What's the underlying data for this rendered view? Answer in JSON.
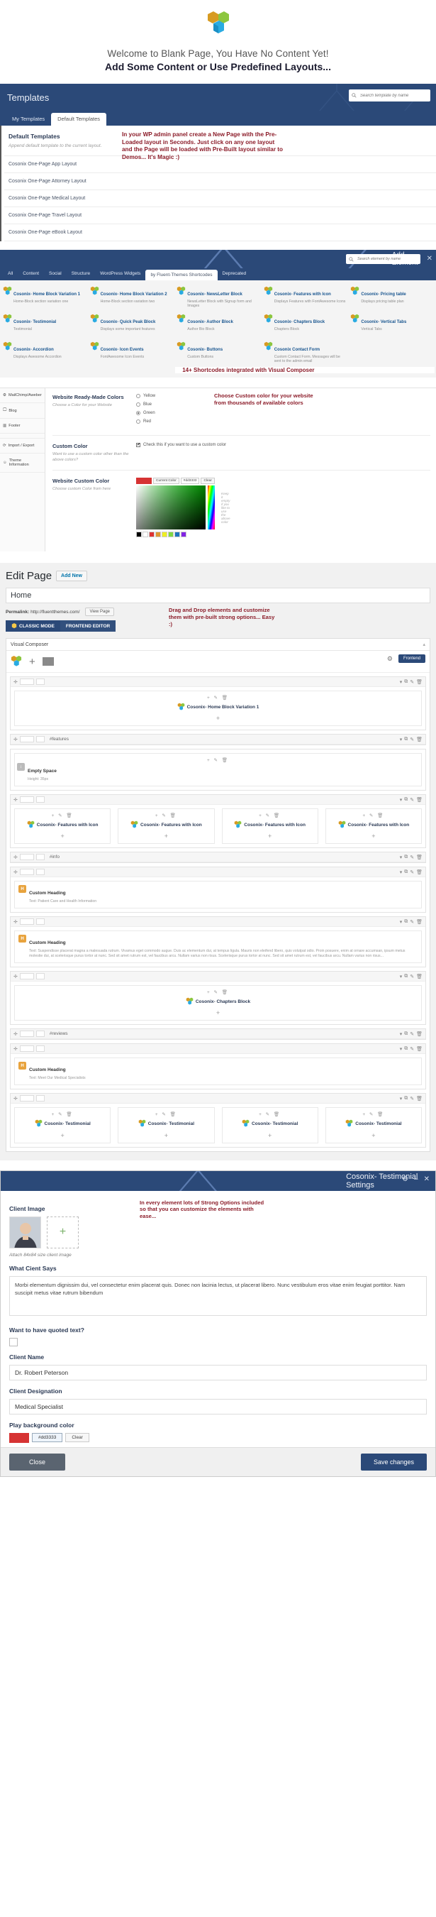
{
  "hero": {
    "logo_icon": "fluent-themes-logo",
    "line1": "Welcome to Blank Page, You Have No Content Yet!",
    "line2": "Add Some Content or Use Predefined Layouts..."
  },
  "templates_panel": {
    "title": "Templates",
    "search_placeholder": "Search template by name",
    "search_icon": "search-icon",
    "tabs": [
      {
        "label": "My Templates",
        "active": false
      },
      {
        "label": "Default Templates",
        "active": true
      }
    ],
    "section_title": "Default Templates",
    "section_sub": "Append default template to the current layout.",
    "rows": [
      "Cosonix One-Page App Layout",
      "Cosonix One-Page Attorney Layout",
      "Cosonix One-Page Medical Layout",
      "Cosonix One-Page Travel Layout",
      "Cosonix One-Page eBook Layout"
    ],
    "annotation": "In your WP admin panel create a New Page with the Pre-Loaded layout in Seconds. Just click on any one layout and the Page will be loaded with Pre-Built layout similar to Demos... It's Magic :)"
  },
  "add_element": {
    "title": "Add Element",
    "search_placeholder": "Search element by name",
    "search_icon": "search-icon",
    "close_icon": "close-icon",
    "tabs": [
      {
        "label": "All",
        "active": false
      },
      {
        "label": "Content",
        "active": false
      },
      {
        "label": "Social",
        "active": false
      },
      {
        "label": "Structure",
        "active": false
      },
      {
        "label": "WordPress Widgets",
        "active": false
      },
      {
        "label": "by Fluent-Themes Shortcodes",
        "active": true
      },
      {
        "label": "Deprecated",
        "active": false
      }
    ],
    "shortcodes": [
      {
        "title": "Cosonix- Home Block Variation 1",
        "desc": "Home-Block section variation one"
      },
      {
        "title": "Cosonix- Home Block Variation 2",
        "desc": "Home-Block section variation two"
      },
      {
        "title": "Cosonix- NewsLetter Block",
        "desc": "NewsLetter Block with Signup form and Images"
      },
      {
        "title": "Cosonix- Features with Icon",
        "desc": "Displays Features with FontAwesome Icons"
      },
      {
        "title": "Cosonix- Pricing table",
        "desc": "Displays pricing table plan"
      },
      {
        "title": "Cosonix- Testimonial",
        "desc": "Testimonial"
      },
      {
        "title": "Cosonix- Quick Peak Block",
        "desc": "Displays some important features"
      },
      {
        "title": "Cosonix- Author Block",
        "desc": "Author Bio Block"
      },
      {
        "title": "Cosonix- Chapters Block",
        "desc": "Chapters Block"
      },
      {
        "title": "Cosonix- Vertical Tabs",
        "desc": "Vertical Tabs"
      },
      {
        "title": "Cosonix- Accordion",
        "desc": "Displays Awesome Accordion"
      },
      {
        "title": "Cosonix- Icon Events",
        "desc": "FontAwesome Icon Events"
      },
      {
        "title": "Cosonix- Buttons",
        "desc": "Custom Buttons"
      },
      {
        "title": "Cosonix Contact Form",
        "desc": "Custom Contact Form. Messages will be sent to the admin email"
      }
    ],
    "note": "14+ Shortcodes integrated with Visual Composer"
  },
  "color_options": {
    "sidebar": [
      {
        "label": "MailChimp/Aweber",
        "icon": "gear-icon"
      },
      {
        "label": "Blog",
        "icon": "monitor-icon"
      },
      {
        "label": "Footer",
        "icon": "columns-icon"
      },
      {
        "label": "Import / Export",
        "icon": "sync-icon"
      },
      {
        "label": "Theme Information",
        "icon": "info-icon"
      }
    ],
    "sections": [
      {
        "heading": "Website Ready-Made Colors",
        "sub": "Choose a Color for your Website",
        "radios": [
          {
            "label": "Yellow",
            "selected": false
          },
          {
            "label": "Blue",
            "selected": false
          },
          {
            "label": "Green",
            "selected": true
          },
          {
            "label": "Red",
            "selected": false
          }
        ]
      },
      {
        "heading": "Custom Color",
        "sub": "Want to use a custom color other than the above colors?",
        "checkbox_label": "Check this if you want to use a custom color",
        "checkbox_checked": true
      },
      {
        "heading": "Website Custom Color",
        "sub": "Choose custom Color from here",
        "picker": {
          "current_color_label": "Current Color",
          "hex": "#dd3333",
          "clear_label": "Clear",
          "hint": "Keep it empty if you like to use the above color",
          "swatches": [
            "#000000",
            "#ffffff",
            "#dd3333",
            "#dd9933",
            "#eeee22",
            "#81d742",
            "#1e73be",
            "#8224e3"
          ]
        }
      }
    ],
    "annotation": "Choose Custom color for your website from thousands of available colors"
  },
  "edit_page": {
    "title": "Edit Page",
    "add_new_label": "Add New",
    "page_title_value": "Home",
    "permalink_label": "Permalink:",
    "permalink_url": "http://fluentthemes.com/",
    "view_page_label": "View Page",
    "modes": [
      {
        "label": "CLASSIC MODE",
        "icon": "vc-logo-icon",
        "active": true
      },
      {
        "label": "FRONTEND EDITOR",
        "active": false
      }
    ],
    "annotation": "Drag and Drop elements and customize them with pre-built strong options... Easy :)",
    "vc": {
      "panel_title": "Visual Composer",
      "frontend_label": "Frontend",
      "gear_icon": "gear-icon",
      "add_icon": "plus-icon",
      "templates_icon": "grid-icon",
      "logo_icon": "fluent-themes-logo",
      "rows": [
        {
          "type": "element",
          "name": "Cosonix- Home Block Variation 1"
        },
        {
          "type": "tag",
          "name": "#features"
        },
        {
          "type": "empty",
          "name": "Empty Space",
          "sub": "Height: 35px"
        },
        {
          "type": "columns",
          "items": [
            "Cosonix- Features with Icon",
            "Cosonix- Features with Icon",
            "Cosonix- Features with Icon",
            "Cosonix- Features with Icon"
          ]
        },
        {
          "type": "tag",
          "name": "#info"
        },
        {
          "type": "heading",
          "name": "Custom Heading",
          "sub": "Text: Patient Care and Health Information"
        },
        {
          "type": "heading",
          "name": "Custom Heading",
          "sub": "Text: Suspendisse placerat magna a malesuada rutrum. Vivamus eget commodo augue. Duis ac elementum dui, at tempus ligula. Mauris non eleifend libero, quis volutpat odio. Proin posuere, enim at ornare accumsan, ipsum metus molestie dui, at scelerisque purus tortor at nunc. Sed sit amet rutrum est, vel faucibus arcu. Nullam varius non risus. Scelerisque purus tortor at nunc. Sed sit amet rutrum est, vel faucibus arcu. Nullam varius non risus..."
        },
        {
          "type": "element",
          "name": "Cosonix- Chapters Block"
        },
        {
          "type": "tag",
          "name": "#reviews"
        },
        {
          "type": "heading",
          "name": "Custom Heading",
          "sub": "Text: Meet Our Medical Specialists"
        },
        {
          "type": "columns",
          "items": [
            "Cosonix- Testimonial",
            "Cosonix- Testimonial",
            "Cosonix- Testimonial",
            "Cosonix- Testimonial"
          ]
        }
      ]
    }
  },
  "modal": {
    "title": "Cosonix- Testimonial Settings",
    "gear_icon": "gear-icon",
    "minimize_icon": "minimize-icon",
    "close_icon": "close-icon",
    "annotation": "In every element lots of Strong Options included so that you can customize the elements with ease...",
    "fields": {
      "client_image_label": "Client Image",
      "add_image_icon": "plus-icon",
      "client_image_help": "Attach 84x84 size client image",
      "what_says_label": "What Cient Says",
      "what_says_value": "Morbi elementum dignissim dui, vel consectetur enim placerat quis. Donec non lacinia lectus, ut placerat libero. Nunc vestibulum eros vitae enim feugiat porttitor. Nam suscipit metus vitae rutrum bibendum",
      "quoted_label": "Want to have quoted text?",
      "quoted_checked": false,
      "client_name_label": "Client Name",
      "client_name_value": "Dr. Robert Peterson",
      "client_designation_label": "Client Designation",
      "client_designation_value": "Medical Specialist",
      "play_bg_label": "Play background color",
      "play_bg_hex": "#dd3333",
      "clear_label": "Clear"
    },
    "footer": {
      "close_label": "Close",
      "save_label": "Save changes"
    }
  }
}
